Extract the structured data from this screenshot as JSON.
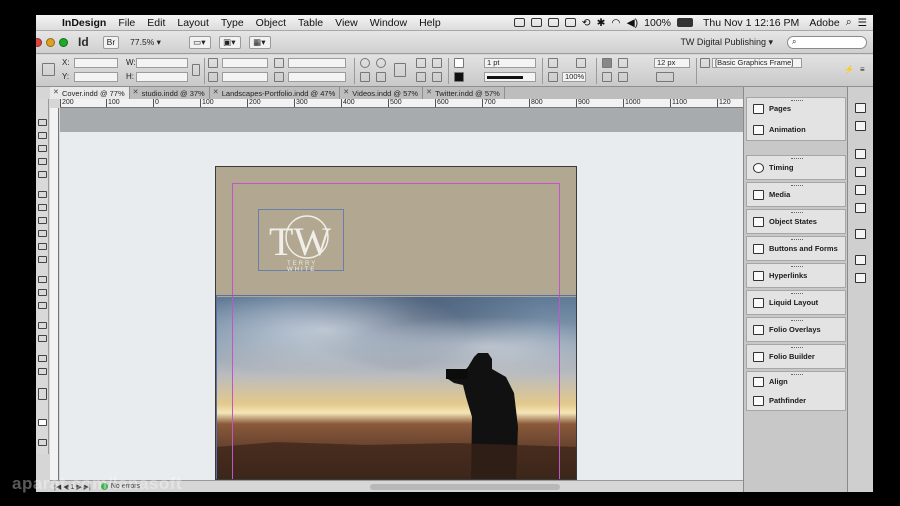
{
  "menubar": {
    "app_name": "InDesign",
    "items": [
      "File",
      "Edit",
      "Layout",
      "Type",
      "Object",
      "Table",
      "View",
      "Window",
      "Help"
    ],
    "battery": "100%",
    "clock": "Thu Nov 1  12:16 PM",
    "user": "Adobe"
  },
  "appbar": {
    "logo": "Id",
    "zoom": "77.5%",
    "workspace": "TW Digital Publishing",
    "search_placeholder": ""
  },
  "control": {
    "x_label": "X:",
    "y_label": "Y:",
    "w_label": "W:",
    "h_label": "H:",
    "stroke_weight": "1 pt",
    "corner_size": "12 px",
    "opacity": "100%",
    "object_style": "[Basic Graphics Frame]"
  },
  "tabs": [
    {
      "label": "Cover.indd @ 77%",
      "active": true
    },
    {
      "label": "studio.indd @ 37%",
      "active": false
    },
    {
      "label": "Landscapes-Portfolio.indd @ 47%",
      "active": false
    },
    {
      "label": "Videos.indd @ 57%",
      "active": false
    },
    {
      "label": "Twitter.indd @ 57%",
      "active": false
    }
  ],
  "ruler": [
    "200",
    "100",
    "0",
    "100",
    "200",
    "300",
    "400",
    "500",
    "600",
    "700",
    "800",
    "900",
    "1000",
    "1100",
    "120"
  ],
  "page": {
    "logo_letters": "TW",
    "logo_caption": "TERRY WHITE"
  },
  "status": {
    "page_number": "1",
    "preflight": "No errors"
  },
  "panels": [
    {
      "label": "Pages",
      "icon": "pages-icon"
    },
    {
      "label": "Animation",
      "icon": "animation-icon"
    },
    {
      "label": "Timing",
      "icon": "timing-icon"
    },
    {
      "label": "Media",
      "icon": "media-icon"
    },
    {
      "label": "Object States",
      "icon": "object-states-icon"
    },
    {
      "label": "Buttons and Forms",
      "icon": "buttons-forms-icon"
    },
    {
      "label": "Hyperlinks",
      "icon": "hyperlinks-icon"
    },
    {
      "label": "Liquid Layout",
      "icon": "liquid-layout-icon"
    },
    {
      "label": "Folio Overlays",
      "icon": "folio-overlays-icon"
    },
    {
      "label": "Folio Builder",
      "icon": "folio-builder-icon"
    },
    {
      "label": "Align",
      "icon": "align-icon"
    },
    {
      "label": "Pathfinder",
      "icon": "pathfinder-icon"
    }
  ],
  "watermark": "aparat.com/lanasoft",
  "colors": {
    "page_top": "#b2a891",
    "guide": "#c455c9",
    "pasteboard": "#e9ecee"
  }
}
